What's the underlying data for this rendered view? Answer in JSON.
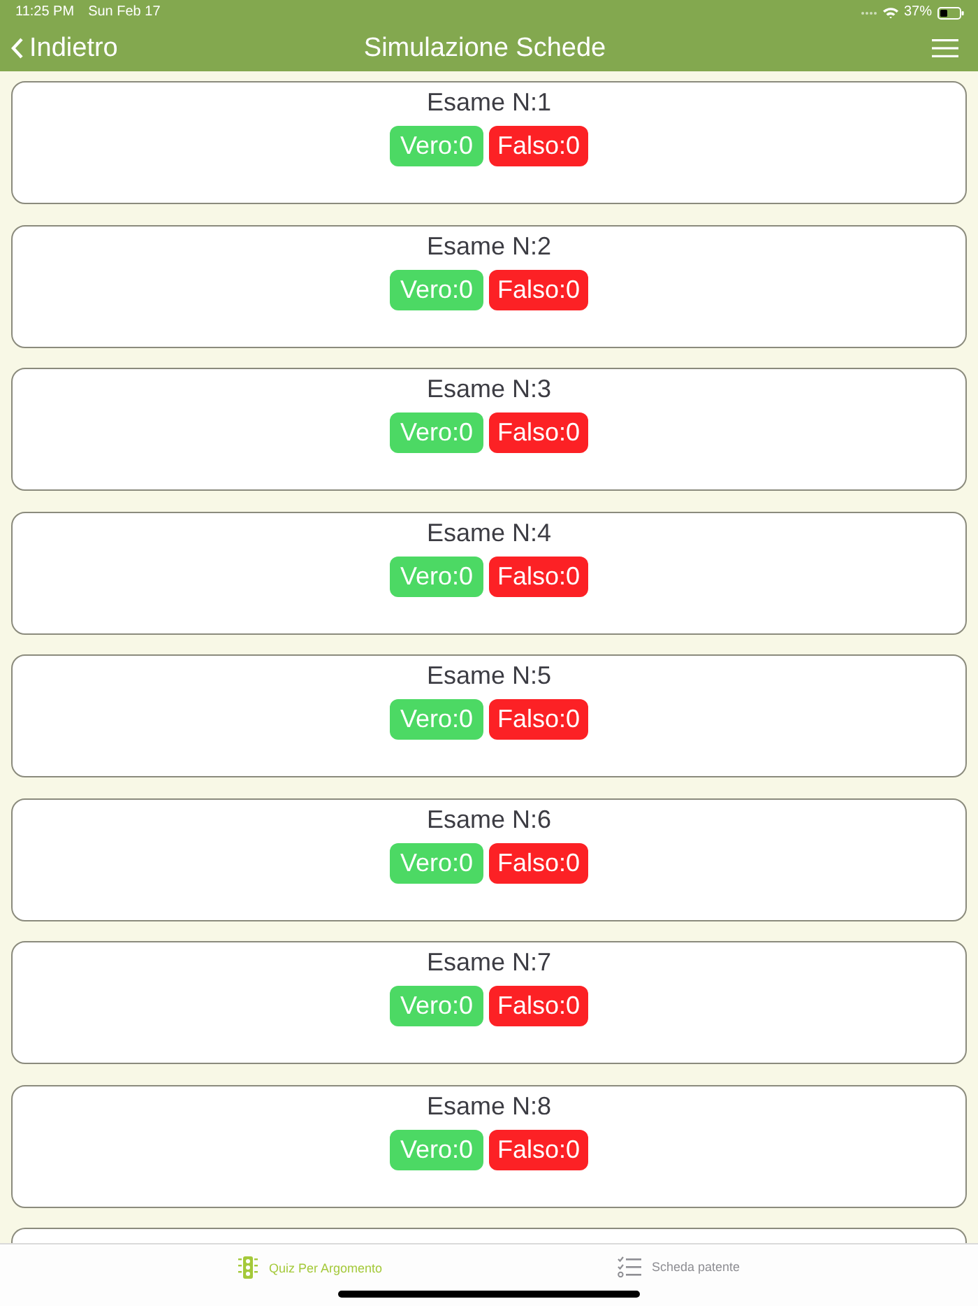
{
  "status_bar": {
    "time": "11:25 PM",
    "date": "Sun Feb 17",
    "battery": "37%"
  },
  "nav_bar": {
    "back": "Indietro",
    "title": "Simulazione Schede"
  },
  "exams": [
    {
      "title": "Esame N:1",
      "badges": [
        {
          "kind": "correct",
          "label": "Vero:0"
        },
        {
          "kind": "wrong",
          "label": "Falso:0"
        }
      ]
    },
    {
      "title": "Esame N:2",
      "badges": [
        {
          "kind": "correct",
          "label": "Vero:0"
        },
        {
          "kind": "wrong",
          "label": "Falso:0"
        }
      ]
    },
    {
      "title": "Esame N:3",
      "badges": [
        {
          "kind": "correct",
          "label": "Vero:0"
        },
        {
          "kind": "wrong",
          "label": "Falso:0"
        }
      ]
    },
    {
      "title": "Esame N:4",
      "badges": [
        {
          "kind": "correct",
          "label": "Vero:0"
        },
        {
          "kind": "wrong",
          "label": "Falso:0"
        }
      ]
    },
    {
      "title": "Esame N:5",
      "badges": [
        {
          "kind": "correct",
          "label": "Vero:0"
        },
        {
          "kind": "wrong",
          "label": "Falso:0"
        }
      ]
    },
    {
      "title": "Esame N:6",
      "badges": [
        {
          "kind": "correct",
          "label": "Vero:0"
        },
        {
          "kind": "wrong",
          "label": "Falso:0"
        }
      ]
    },
    {
      "title": "Esame N:7",
      "badges": [
        {
          "kind": "correct",
          "label": "Vero:0"
        },
        {
          "kind": "wrong",
          "label": "Falso:0"
        }
      ]
    },
    {
      "title": "Esame N:8",
      "badges": [
        {
          "kind": "correct",
          "label": "Vero:0"
        },
        {
          "kind": "wrong",
          "label": "Falso:0"
        }
      ]
    }
  ],
  "more_exams_below": true,
  "tab_bar": {
    "items": [
      {
        "kind": "quiz",
        "label": "Quiz Per Argomento",
        "selected": true
      },
      {
        "kind": "sheet",
        "label": "Scheda patente",
        "selected": false
      }
    ]
  }
}
